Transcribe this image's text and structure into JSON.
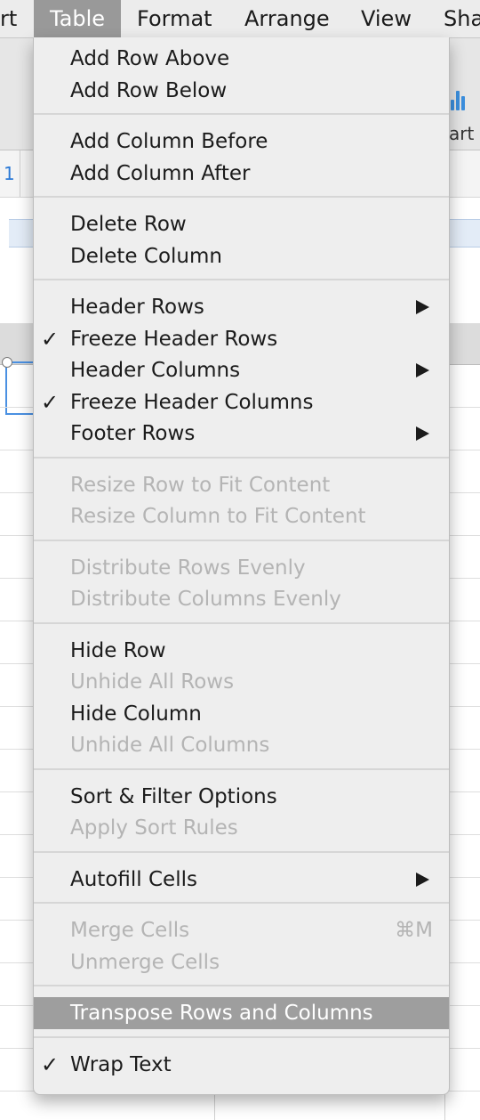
{
  "menubar": {
    "items": [
      "rt",
      "Table",
      "Format",
      "Arrange",
      "View",
      "Sha"
    ],
    "active": "Table"
  },
  "background": {
    "sheet_tab_label": "1",
    "toolbar_chart_label": "art"
  },
  "menu": {
    "groups": [
      [
        {
          "label": "Add Row Above"
        },
        {
          "label": "Add Row Below"
        }
      ],
      [
        {
          "label": "Add Column Before"
        },
        {
          "label": "Add Column After"
        }
      ],
      [
        {
          "label": "Delete Row"
        },
        {
          "label": "Delete Column"
        }
      ],
      [
        {
          "label": "Header Rows",
          "submenu": true
        },
        {
          "label": "Freeze Header Rows",
          "checked": true
        },
        {
          "label": "Header Columns",
          "submenu": true
        },
        {
          "label": "Freeze Header Columns",
          "checked": true
        },
        {
          "label": "Footer Rows",
          "submenu": true
        }
      ],
      [
        {
          "label": "Resize Row to Fit Content",
          "disabled": true
        },
        {
          "label": "Resize Column to Fit Content",
          "disabled": true
        }
      ],
      [
        {
          "label": "Distribute Rows Evenly",
          "disabled": true
        },
        {
          "label": "Distribute Columns Evenly",
          "disabled": true
        }
      ],
      [
        {
          "label": "Hide Row"
        },
        {
          "label": "Unhide All Rows",
          "disabled": true
        },
        {
          "label": "Hide Column"
        },
        {
          "label": "Unhide All Columns",
          "disabled": true
        }
      ],
      [
        {
          "label": "Sort & Filter Options"
        },
        {
          "label": "Apply Sort Rules",
          "disabled": true
        }
      ],
      [
        {
          "label": "Autofill Cells",
          "submenu": true
        }
      ],
      [
        {
          "label": "Merge Cells",
          "disabled": true,
          "shortcut": "⌘M"
        },
        {
          "label": "Unmerge Cells",
          "disabled": true
        }
      ],
      [
        {
          "label": "Transpose Rows and Columns",
          "highlighted": true
        }
      ],
      [
        {
          "label": "Wrap Text",
          "checked": true
        }
      ]
    ],
    "checkmark_glyph": "✓"
  },
  "colors": {
    "menu_background": "#eeeeee",
    "highlight": "#9e9e9e",
    "disabled_text": "#b4b4b4",
    "accent_blue": "#3b8fde"
  }
}
